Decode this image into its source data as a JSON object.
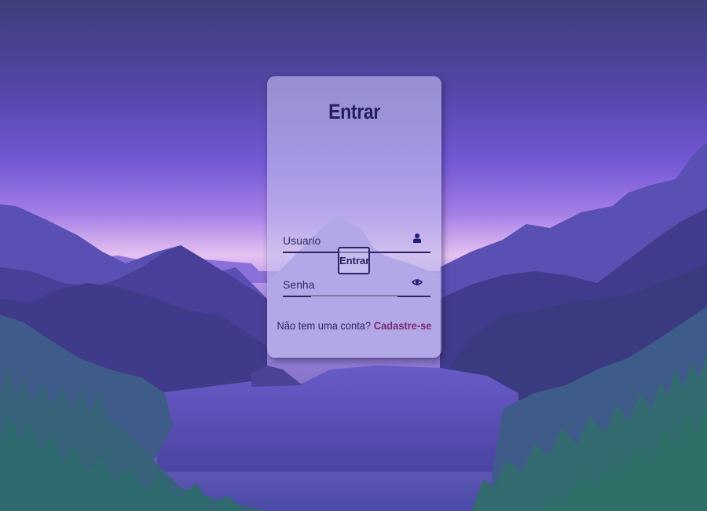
{
  "login": {
    "title": "Entrar",
    "username": {
      "placeholder": "Usuario",
      "value": "",
      "icon": "user-icon"
    },
    "password": {
      "placeholder": "Senha",
      "value": "",
      "icon": "eye-icon"
    },
    "submit_label": "Entrar",
    "signup_prompt": "Não tem uma conta?",
    "signup_link": "Cadastre-se"
  },
  "colors": {
    "card_text": "#25205e",
    "link": "#7a2a6e",
    "sky_top": "#3c3f7a",
    "sky_glow": "#e9c2f0"
  }
}
